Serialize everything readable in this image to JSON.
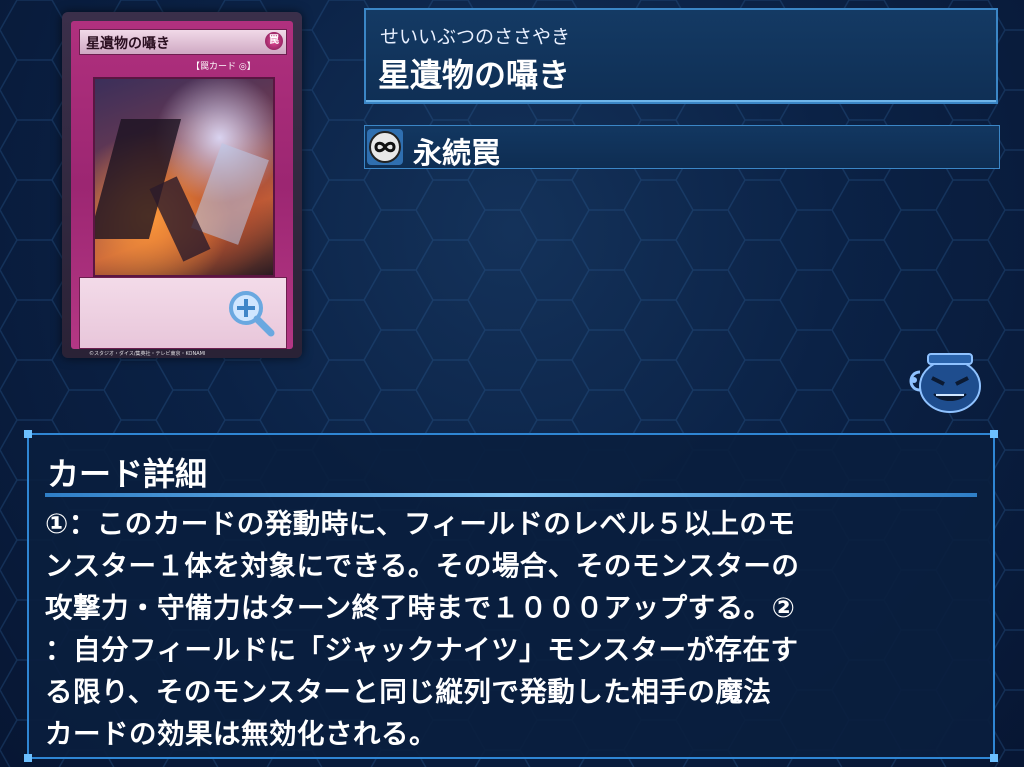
{
  "card": {
    "name": "星遺物の囁き",
    "attribute": "罠",
    "type_label": "【罠カード ◎】",
    "copyright": "©スタジオ・ダイス/集英社・テレビ東京・KONAMI"
  },
  "info": {
    "ruby": "せいいぶつのささやき",
    "title": "星遺物の囁き",
    "card_type": "永続罠",
    "card_type_icon": "infinity-icon"
  },
  "detail": {
    "header": "カード詳細",
    "lines": [
      "①：このカードの発動時に、フィールドのレベル５以上のモ",
      "ンスター１体を対象にできる。その場合、そのモンスターの",
      "攻撃力・守備力はターン終了時まで１０００アップする。②",
      "：自分フィールドに「ジャックナイツ」モンスターが存在す",
      "る限り、そのモンスターと同じ縦列で発動した相手の魔法",
      "カードの効果は無効化される。"
    ]
  },
  "colors": {
    "background": "#0b2246",
    "panel_border": "#3b86c6",
    "card_trap": "#b0307e"
  }
}
